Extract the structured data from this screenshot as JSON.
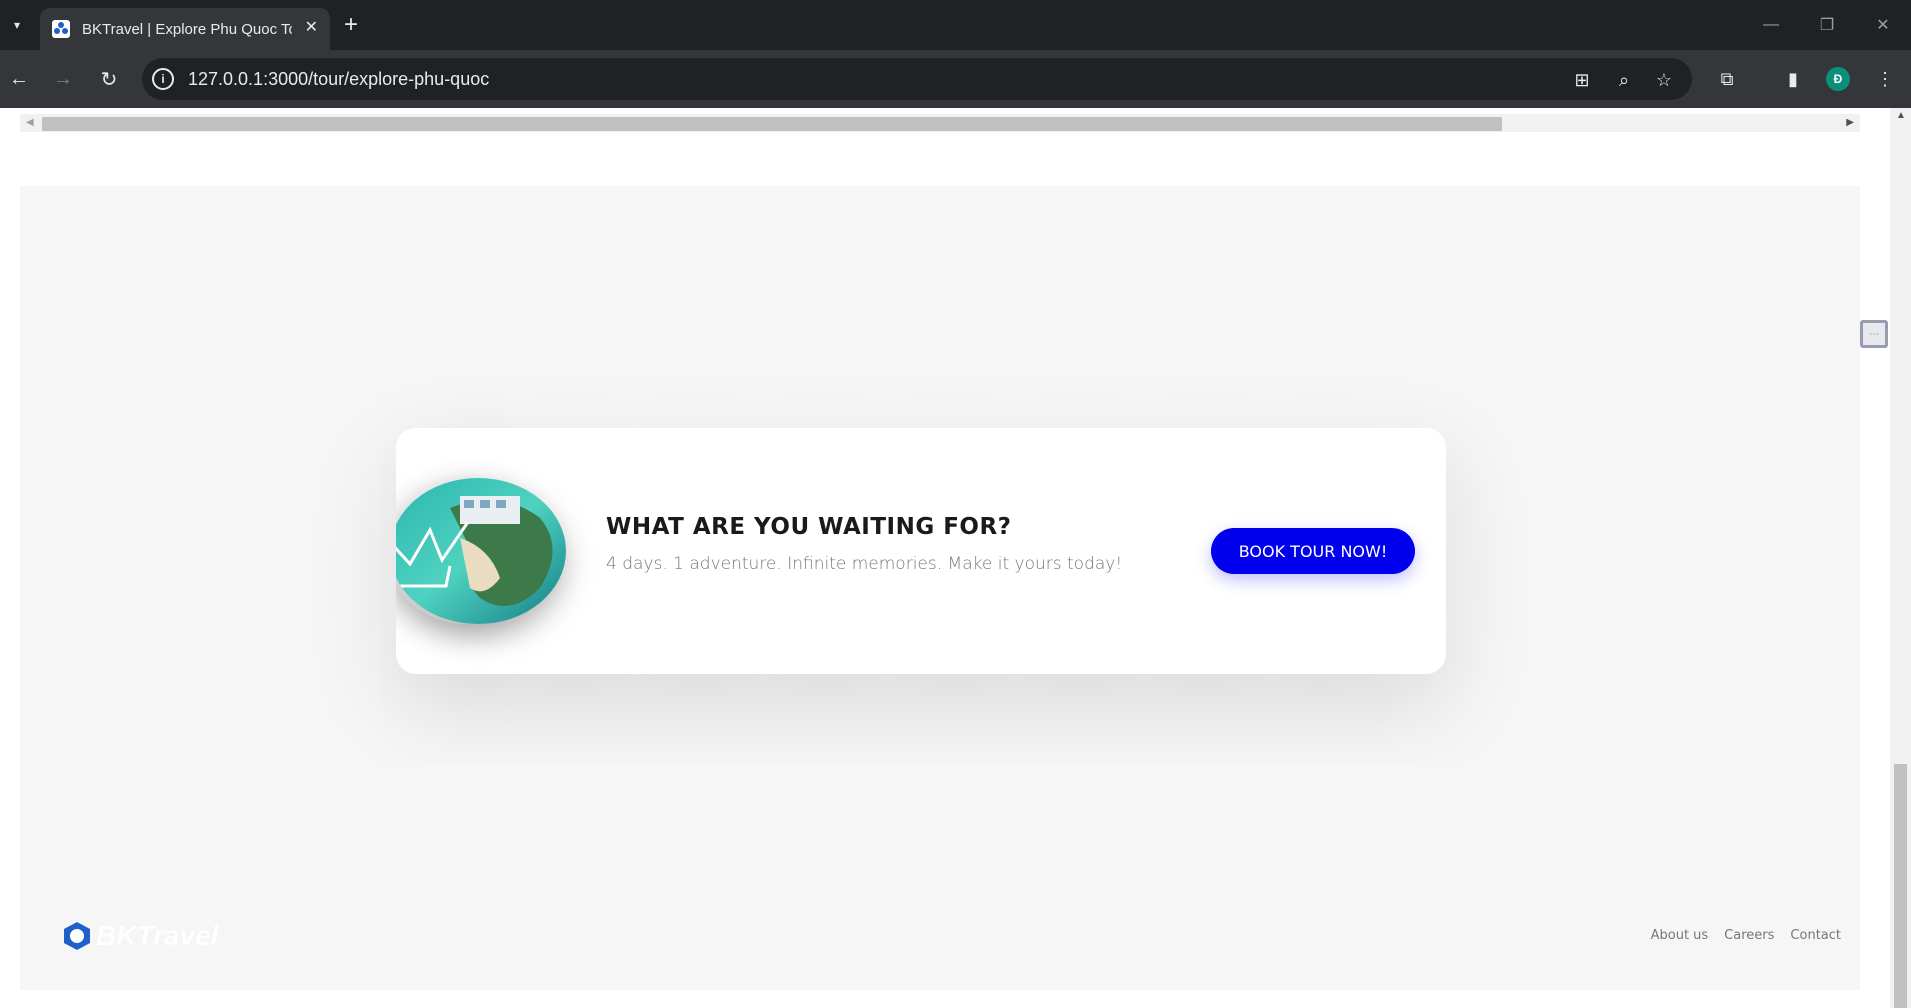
{
  "browser": {
    "tab_title": "BKTravel | Explore Phu Quoc Tour",
    "url": "127.0.0.1:3000/tour/explore-phu-quoc",
    "profile_initial": "Đ"
  },
  "cta": {
    "heading": "WHAT ARE YOU WAITING FOR?",
    "subtitle": "4 days. 1 adventure. Infinite memories. Make it yours today!",
    "button_label": "BOOK TOUR NOW!"
  },
  "footer": {
    "logo_text": "BKTravel",
    "logo_badge": "BK",
    "links": [
      "About us",
      "Careers",
      "Contact"
    ]
  },
  "colors": {
    "accent": "#0000ee",
    "section_bg": "#f6f6f6",
    "logo_blue": "#1e5fc9"
  }
}
